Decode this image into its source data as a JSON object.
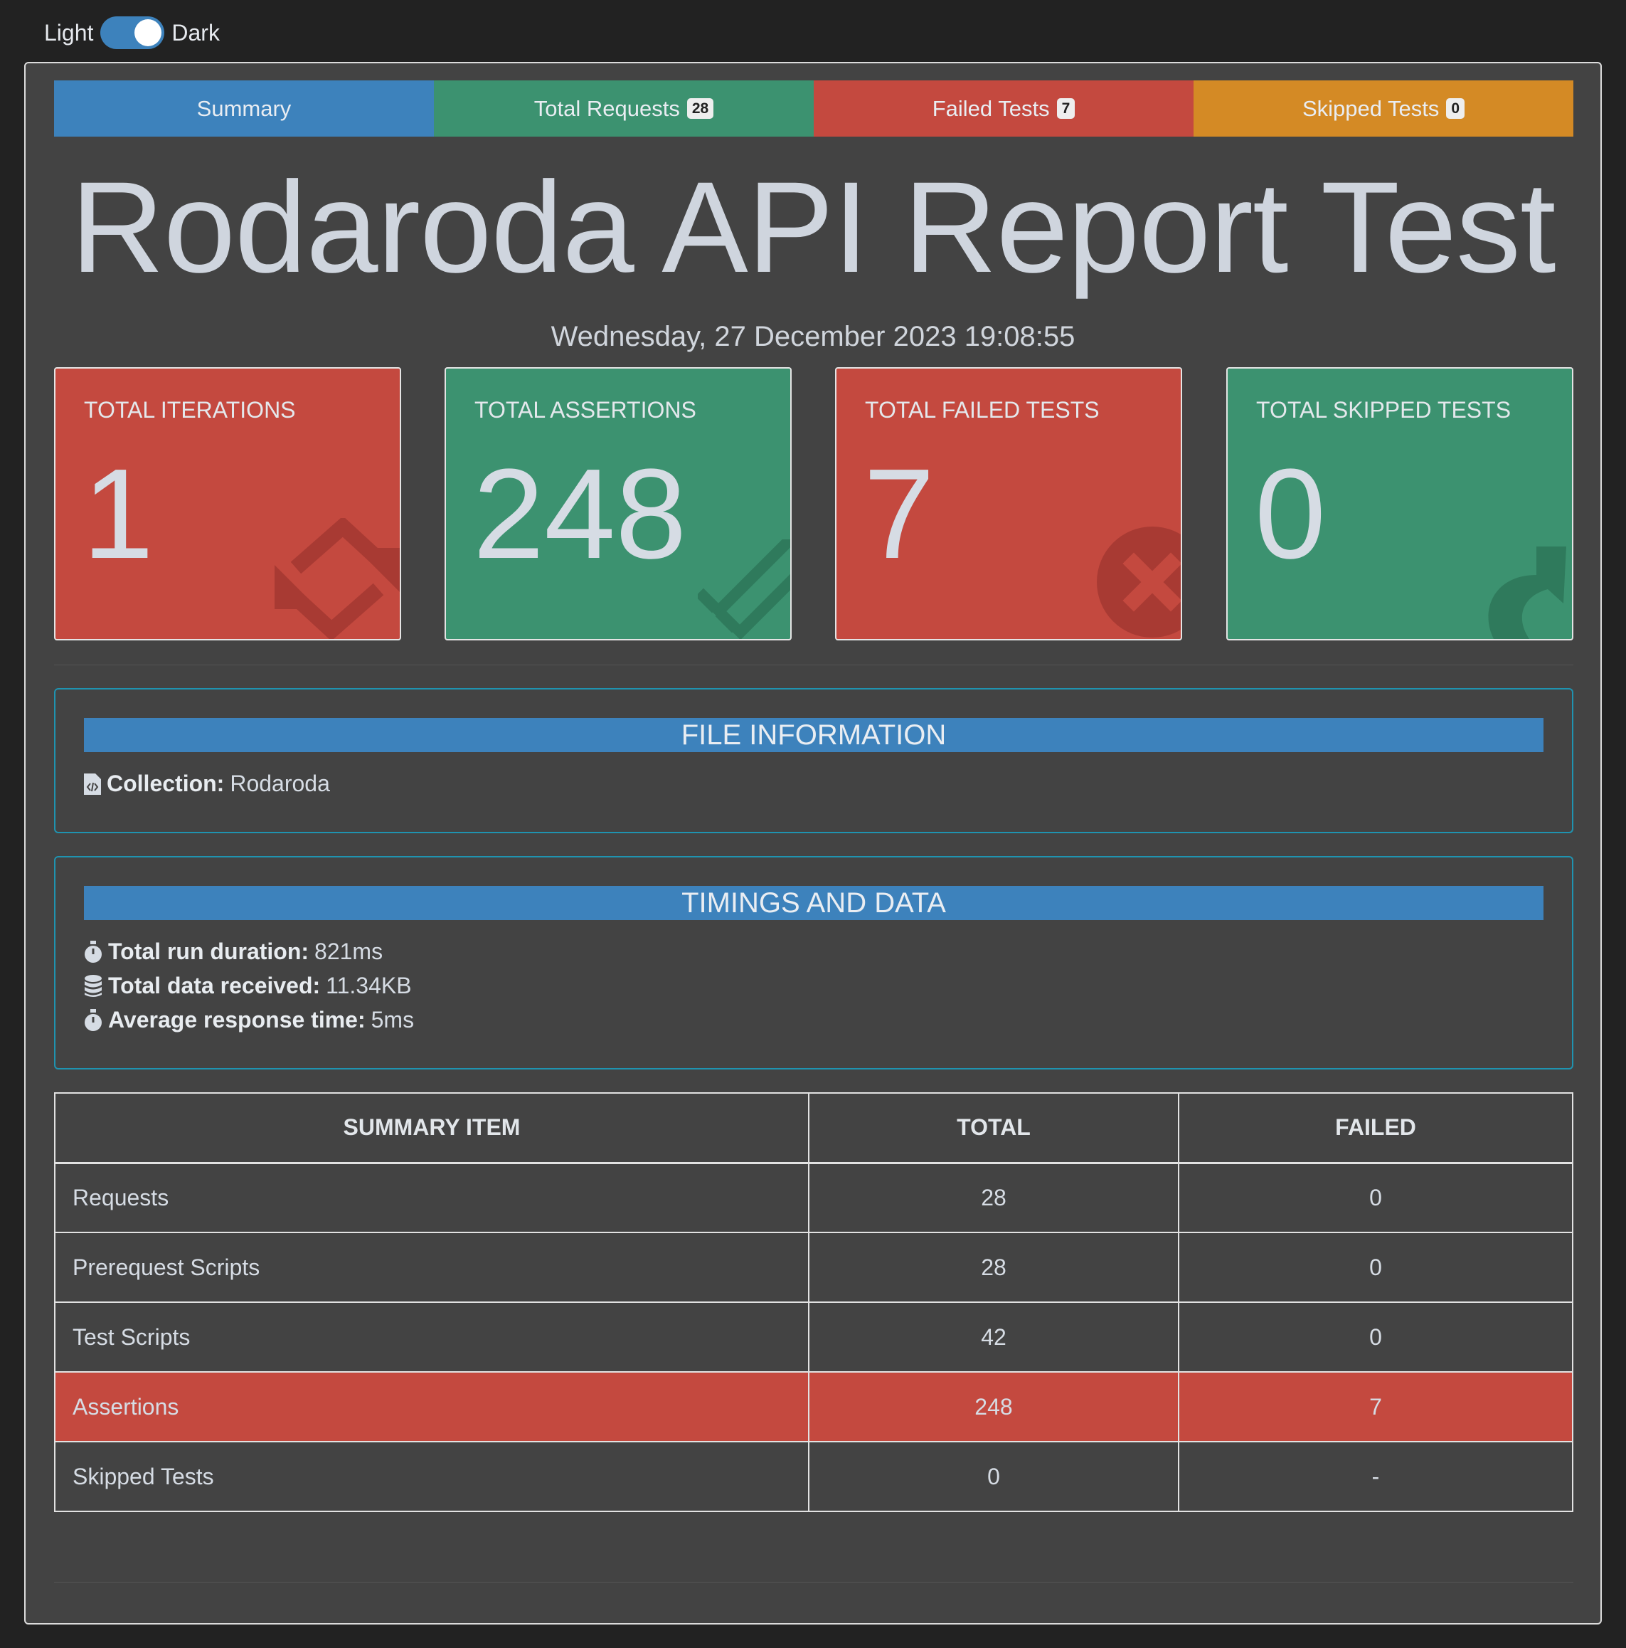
{
  "theme_toggle": {
    "light_label": "Light",
    "dark_label": "Dark",
    "state": "dark"
  },
  "tabs": [
    {
      "label": "Summary",
      "badge": null
    },
    {
      "label": "Total Requests",
      "badge": "28"
    },
    {
      "label": "Failed Tests",
      "badge": "7"
    },
    {
      "label": "Skipped Tests",
      "badge": "0"
    }
  ],
  "header": {
    "title": "Rodaroda API Report Test",
    "date": "Wednesday, 27 December 2023 19:08:55"
  },
  "cards": [
    {
      "label": "TOTAL ITERATIONS",
      "value": "1",
      "color": "#c4493f",
      "icon": "sync-icon"
    },
    {
      "label": "TOTAL ASSERTIONS",
      "value": "248",
      "color": "#3c9270",
      "icon": "list-check-icon"
    },
    {
      "label": "TOTAL FAILED TESTS",
      "value": "7",
      "color": "#c4493f",
      "icon": "times-circle-icon"
    },
    {
      "label": "TOTAL SKIPPED TESTS",
      "value": "0",
      "color": "#3c9270",
      "icon": "share-arrow-icon"
    }
  ],
  "file_info": {
    "heading": "FILE INFORMATION",
    "collection_label": "Collection:",
    "collection_value": "Rodaroda"
  },
  "timings": {
    "heading": "TIMINGS AND DATA",
    "items": [
      {
        "label": "Total run duration:",
        "value": "821ms",
        "icon": "stopwatch-icon"
      },
      {
        "label": "Total data received:",
        "value": "11.34KB",
        "icon": "database-icon"
      },
      {
        "label": "Average response time:",
        "value": "5ms",
        "icon": "stopwatch-icon"
      }
    ]
  },
  "summary_table": {
    "columns": [
      "SUMMARY ITEM",
      "TOTAL",
      "FAILED"
    ],
    "rows": [
      {
        "item": "Requests",
        "total": "28",
        "failed": "0"
      },
      {
        "item": "Prerequest Scripts",
        "total": "28",
        "failed": "0"
      },
      {
        "item": "Test Scripts",
        "total": "42",
        "failed": "0"
      },
      {
        "item": "Assertions",
        "total": "248",
        "failed": "7",
        "highlight": "#c4493f"
      },
      {
        "item": "Skipped Tests",
        "total": "0",
        "failed": "-"
      }
    ]
  },
  "colors": {
    "primary": "#3d82bc",
    "success": "#3c9270",
    "danger": "#c4493f",
    "warning": "#d48a25",
    "panel_border": "#1f93b0"
  }
}
